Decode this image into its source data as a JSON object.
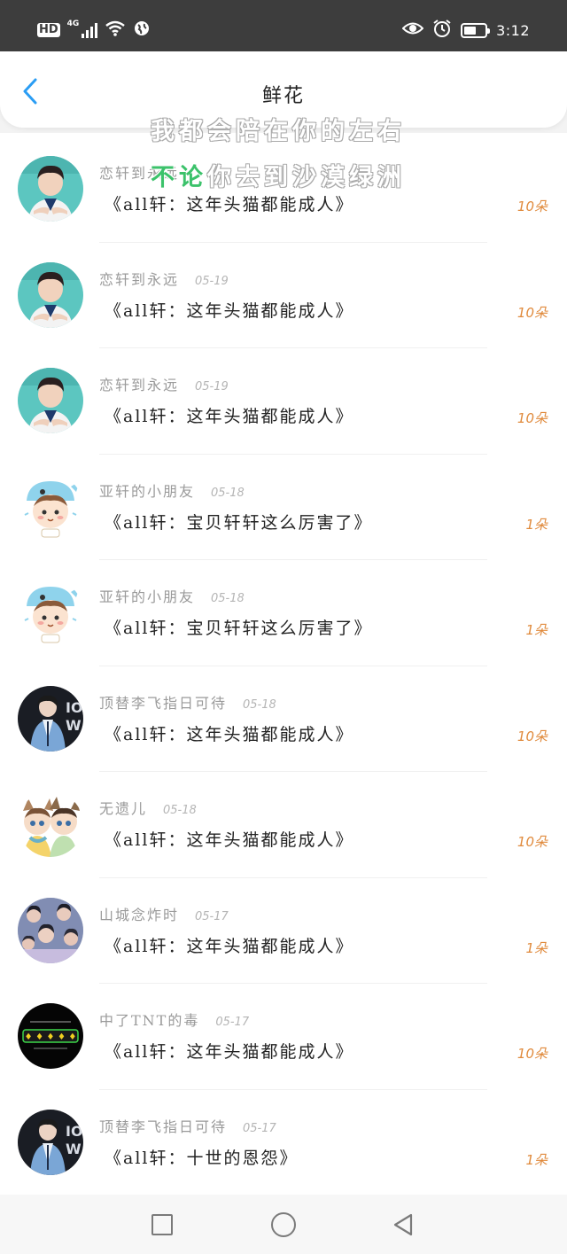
{
  "status_bar": {
    "hd": "HD",
    "network": "4G",
    "time": "3:12"
  },
  "header": {
    "title": "鲜花"
  },
  "watermark": {
    "line1": "我都会陪在你的左右",
    "line2_highlight": "不论",
    "line2_rest": "你去到沙漠绿洲"
  },
  "items": [
    {
      "name": "恋轩到永远",
      "date": "",
      "work": "《all轩：这年头猫都能成人》",
      "count": "10朵",
      "avatar": "boy-teal"
    },
    {
      "name": "恋轩到永远",
      "date": "05-19",
      "work": "《all轩：这年头猫都能成人》",
      "count": "10朵",
      "avatar": "boy-teal"
    },
    {
      "name": "恋轩到永远",
      "date": "05-19",
      "work": "《all轩：这年头猫都能成人》",
      "count": "10朵",
      "avatar": "boy-teal"
    },
    {
      "name": "亚轩的小朋友",
      "date": "05-18",
      "work": "《all轩：宝贝轩轩这么厉害了》",
      "count": "1朵",
      "avatar": "cartoon-dolphin"
    },
    {
      "name": "亚轩的小朋友",
      "date": "05-18",
      "work": "《all轩：宝贝轩轩这么厉害了》",
      "count": "1朵",
      "avatar": "cartoon-dolphin"
    },
    {
      "name": "顶替李飞指日可待",
      "date": "05-18",
      "work": "《all轩：这年头猫都能成人》",
      "count": "10朵",
      "avatar": "boy-blue-dark"
    },
    {
      "name": "无遗儿",
      "date": "05-18",
      "work": "《all轩：这年头猫都能成人》",
      "count": "10朵",
      "avatar": "cartoon-cats"
    },
    {
      "name": "山城念炸时",
      "date": "05-17",
      "work": "《all轩：这年头猫都能成人》",
      "count": "1朵",
      "avatar": "group-photo"
    },
    {
      "name": "中了TNT的毒",
      "date": "05-17",
      "work": "《all轩：这年头猫都能成人》",
      "count": "10朵",
      "avatar": "black-text"
    },
    {
      "name": "顶替李飞指日可待",
      "date": "05-17",
      "work": "《all轩：十世的恩怨》",
      "count": "1朵",
      "avatar": "boy-blue-dark"
    }
  ],
  "colors": {
    "status_bar": "#3d3d3d",
    "back_arrow": "#2a9df4",
    "count": "#e08a3c",
    "watermark_highlight": "#3cc26b"
  },
  "icons": {
    "back": "chevron-left-icon",
    "eye": "eye-icon",
    "alarm": "alarm-icon",
    "wifi": "wifi-icon",
    "battery": "battery-icon"
  }
}
